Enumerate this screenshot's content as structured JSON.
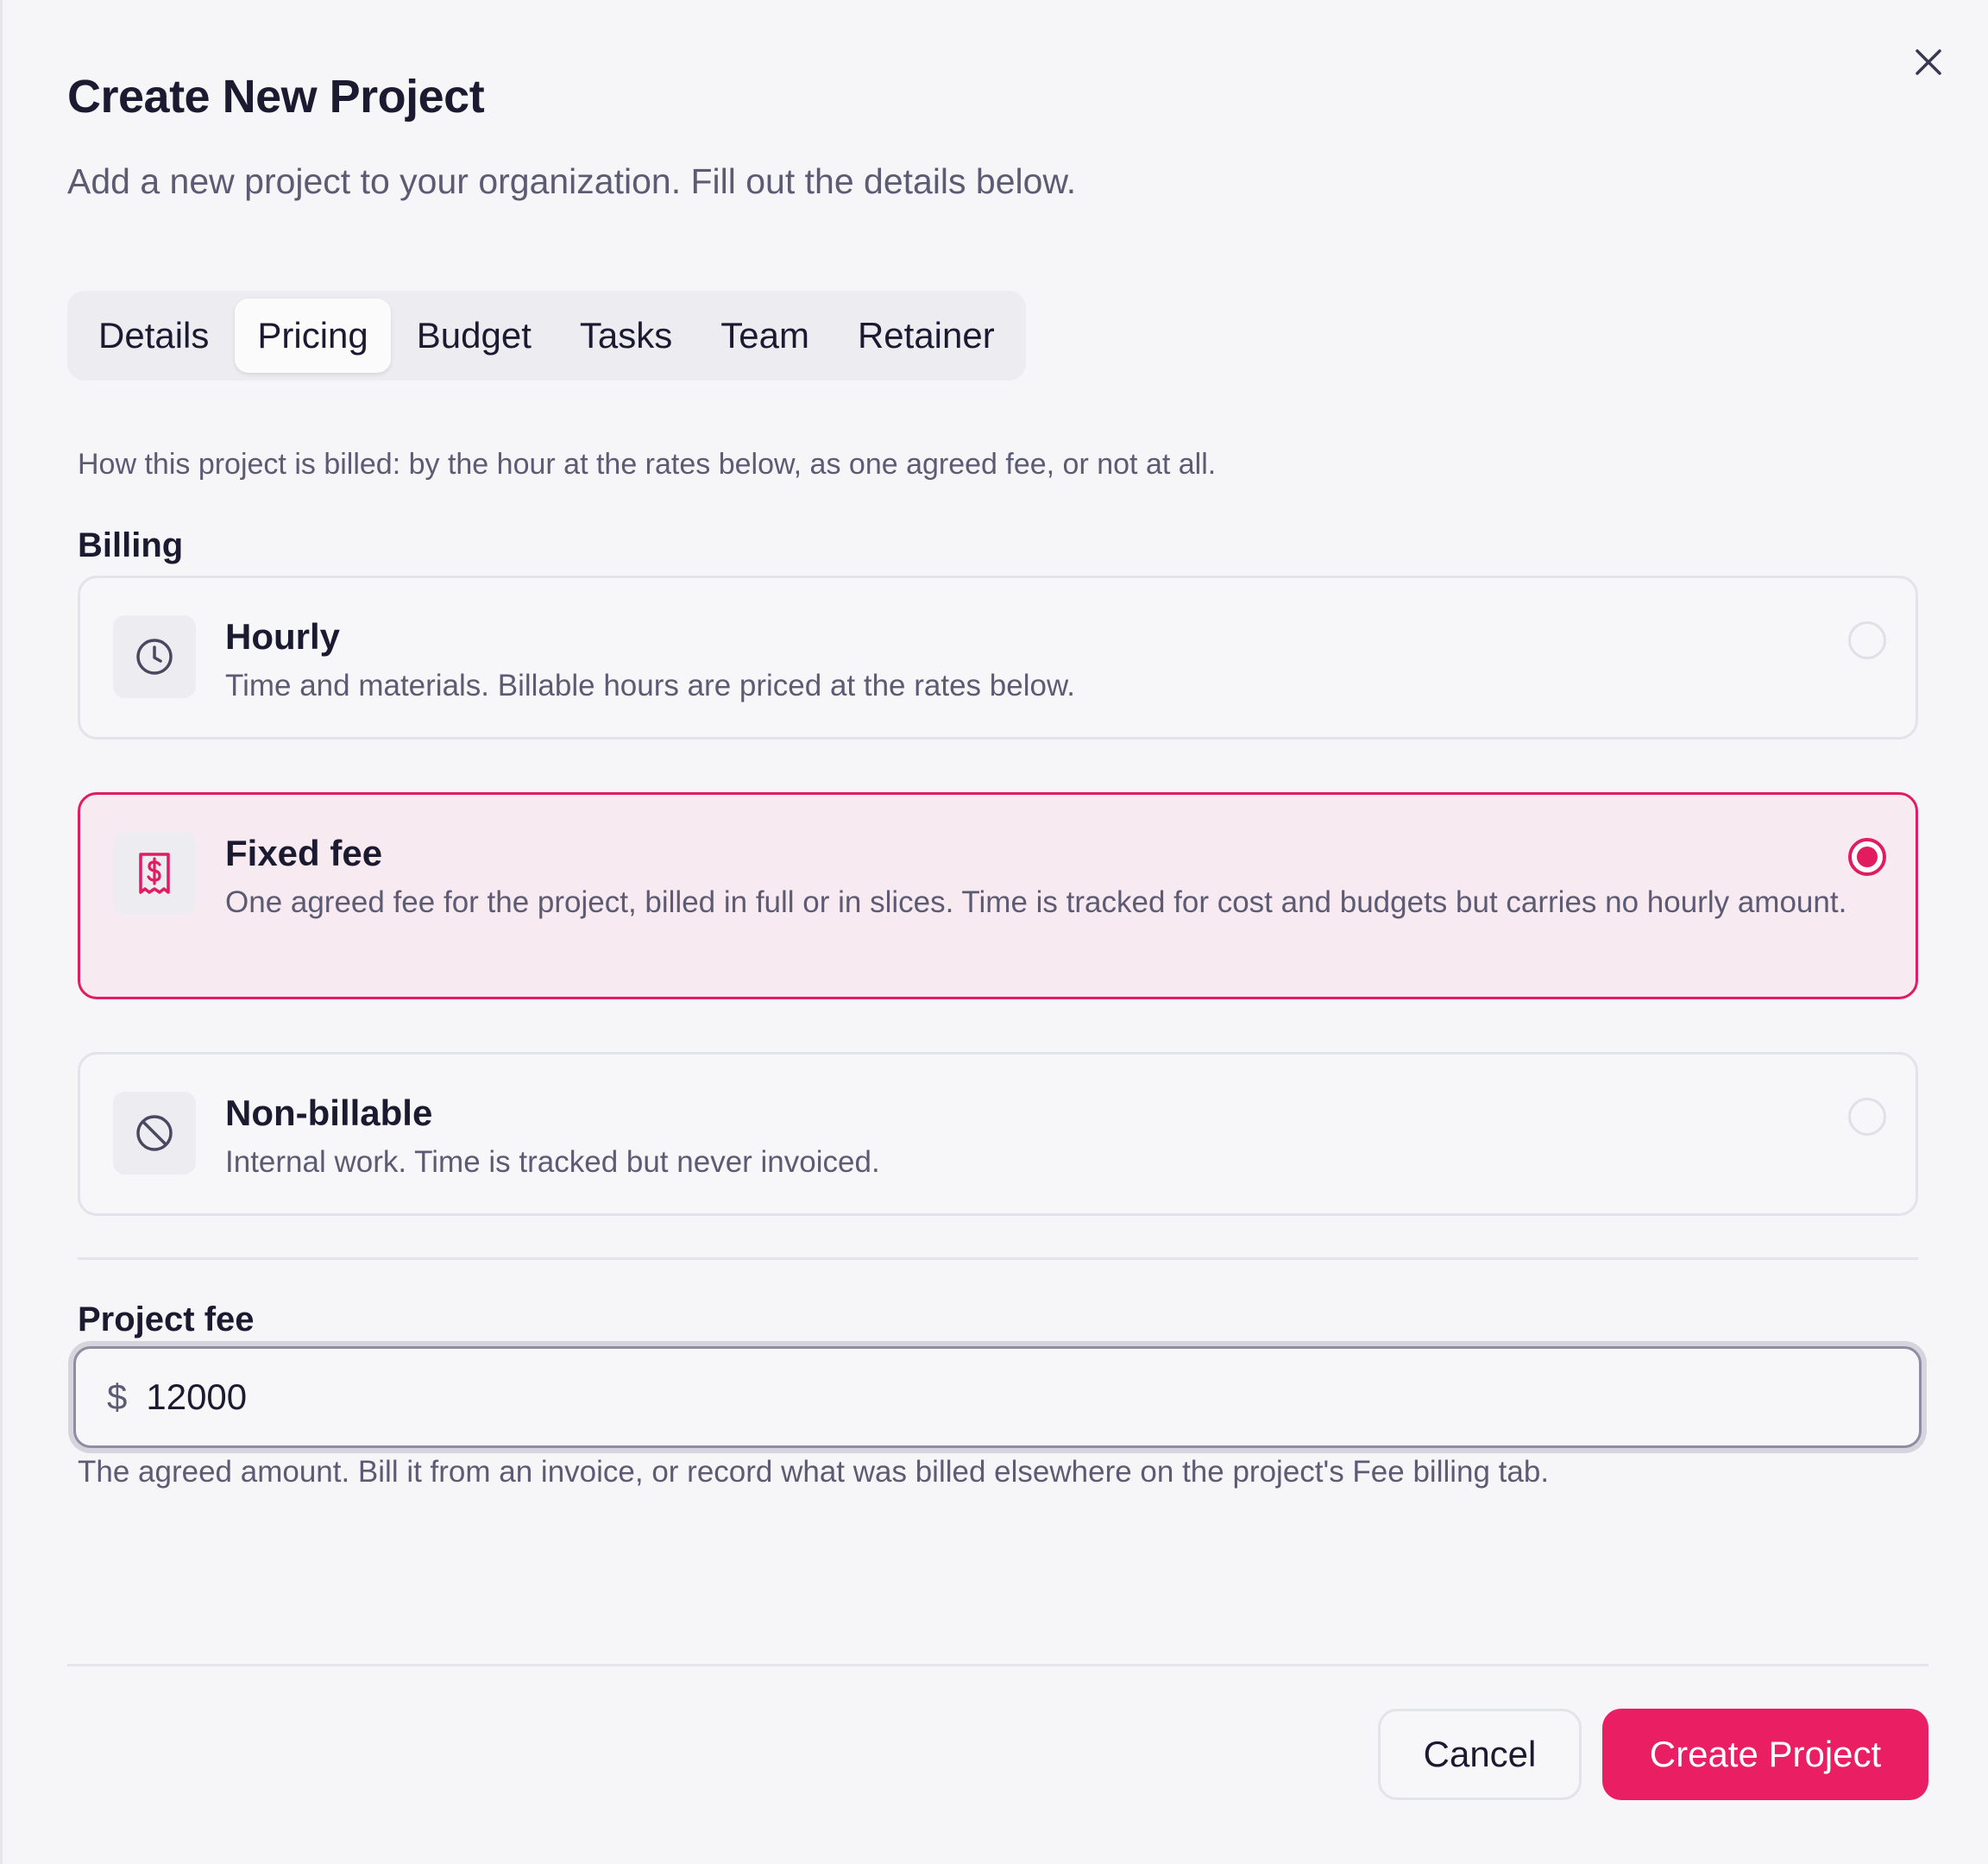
{
  "dialog": {
    "title": "Create New Project",
    "subtitle": "Add a new project to your organization. Fill out the details below."
  },
  "tabs": [
    {
      "label": "Details",
      "active": false
    },
    {
      "label": "Pricing",
      "active": true
    },
    {
      "label": "Budget",
      "active": false
    },
    {
      "label": "Tasks",
      "active": false
    },
    {
      "label": "Team",
      "active": false
    },
    {
      "label": "Retainer",
      "active": false
    }
  ],
  "pricing": {
    "help_text": "How this project is billed: by the hour at the rates below, as one agreed fee, or not at all.",
    "billing_label": "Billing",
    "options": [
      {
        "title": "Hourly",
        "description": "Time and materials. Billable hours are priced at the rates below.",
        "icon": "clock-icon",
        "selected": false
      },
      {
        "title": "Fixed fee",
        "description": "One agreed fee for the project, billed in full or in slices. Time is tracked for cost and budgets but carries no hourly amount.",
        "icon": "receipt-dollar-icon",
        "selected": true
      },
      {
        "title": "Non-billable",
        "description": "Internal work. Time is tracked but never invoiced.",
        "icon": "ban-icon",
        "selected": false
      }
    ],
    "project_fee": {
      "label": "Project fee",
      "currency": "$",
      "value": "12000",
      "help": "The agreed amount. Bill it from an invoice, or record what was billed elsewhere on the project's Fee billing tab."
    }
  },
  "footer": {
    "cancel_label": "Cancel",
    "submit_label": "Create Project"
  },
  "colors": {
    "accent": "#e91e63",
    "selected_bg": "#f7eaf0",
    "text_primary": "#1c1a30",
    "text_secondary": "#5d5a73"
  }
}
